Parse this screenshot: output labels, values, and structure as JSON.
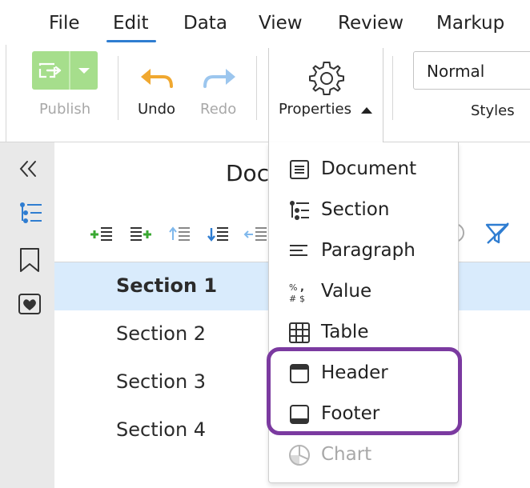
{
  "menu": {
    "items": [
      "File",
      "Edit",
      "Data",
      "View",
      "Review",
      "Markup"
    ],
    "active": "Edit"
  },
  "ribbon": {
    "publish_label": "Publish",
    "undo_label": "Undo",
    "redo_label": "Redo",
    "properties_label": "Properties",
    "styles_value": "Normal",
    "styles_label": "Styles"
  },
  "document": {
    "title_visible": "Doc",
    "sections": [
      "Section 1",
      "Section 2",
      "Section 3",
      "Section 4"
    ],
    "selected_section": "Section 1"
  },
  "properties_menu": {
    "items": [
      {
        "label": "Document",
        "icon": "document-icon",
        "enabled": true
      },
      {
        "label": "Section",
        "icon": "section-icon",
        "enabled": true
      },
      {
        "label": "Paragraph",
        "icon": "paragraph-icon",
        "enabled": true
      },
      {
        "label": "Value",
        "icon": "value-icon",
        "enabled": true
      },
      {
        "label": "Table",
        "icon": "table-icon",
        "enabled": true
      },
      {
        "label": "Header",
        "icon": "header-icon",
        "enabled": true
      },
      {
        "label": "Footer",
        "icon": "footer-icon",
        "enabled": true
      },
      {
        "label": "Chart",
        "icon": "chart-icon",
        "enabled": false
      }
    ]
  },
  "colors": {
    "accent": "#2f7dd1",
    "publish_green": "#a6de8c",
    "undo_orange": "#f0a830",
    "redo_blue": "#9cc6ee",
    "selection": "#d9ebfc",
    "highlight_purple": "#7b3aa0"
  }
}
